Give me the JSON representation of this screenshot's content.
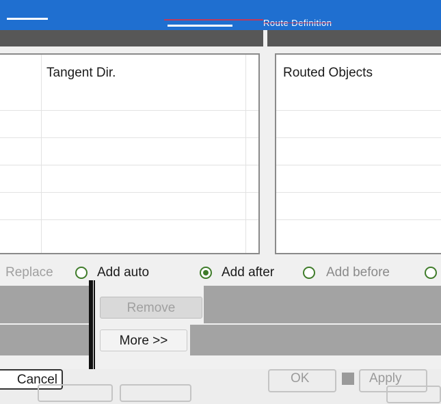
{
  "title": {
    "text": "Route Definition"
  },
  "panels": {
    "left": {
      "column_header": "Tangent Dir."
    },
    "right": {
      "column_header": "Routed Objects"
    }
  },
  "mode_options": [
    {
      "label": "Replace",
      "checked": false
    },
    {
      "label": "Add auto",
      "checked": false
    },
    {
      "label": "Add after",
      "checked": true
    },
    {
      "label": "Add before",
      "checked": false
    }
  ],
  "buttons": {
    "remove": "Remove",
    "more": "More >>",
    "ok": "OK",
    "apply": "Apply",
    "cancel": "Cancel"
  },
  "colors": {
    "titlebar": "#1f6fd0",
    "radio_accent": "#3f7c2a",
    "panel_header": "#575757"
  }
}
